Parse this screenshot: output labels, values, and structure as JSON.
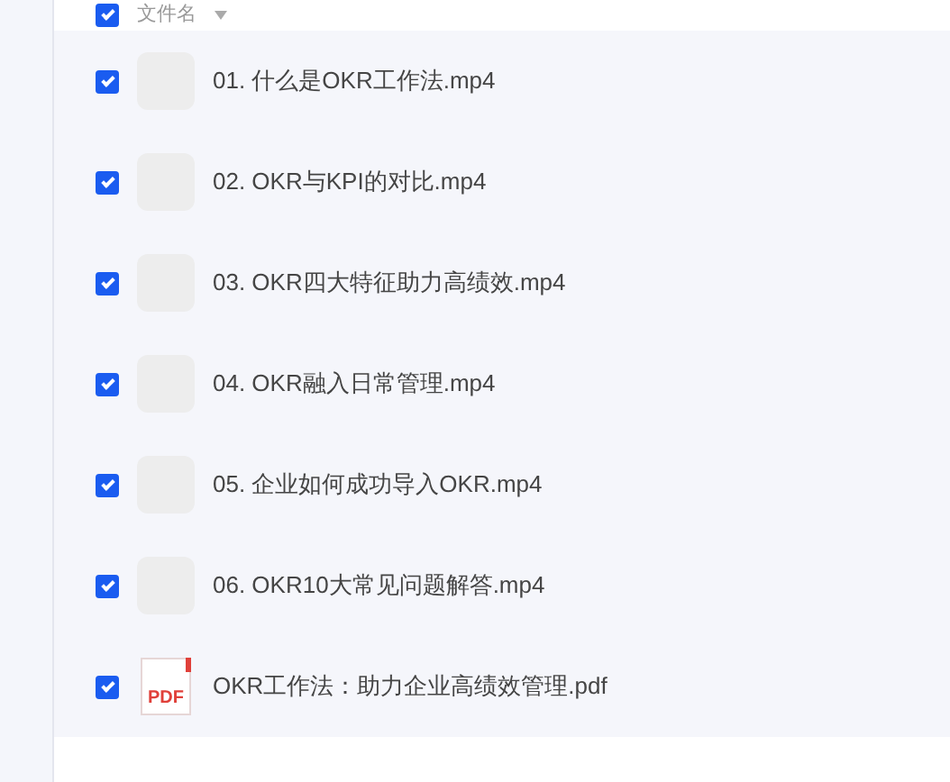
{
  "header": {
    "checked": true,
    "label": "文件名"
  },
  "files": [
    {
      "kind": "video",
      "name": "01. 什么是OKR工作法.mp4",
      "checked": true
    },
    {
      "kind": "video",
      "name": "02. OKR与KPI的对比.mp4",
      "checked": true
    },
    {
      "kind": "video",
      "name": "03. OKR四大特征助力高绩效.mp4",
      "checked": true
    },
    {
      "kind": "video",
      "name": "04. OKR融入日常管理.mp4",
      "checked": true
    },
    {
      "kind": "video",
      "name": "05. 企业如何成功导入OKR.mp4",
      "checked": true
    },
    {
      "kind": "video",
      "name": "06. OKR10大常见问题解答.mp4",
      "checked": true
    },
    {
      "kind": "pdf",
      "name": "OKR工作法：助力企业高绩效管理.pdf",
      "checked": true,
      "badge": "PDF"
    }
  ]
}
